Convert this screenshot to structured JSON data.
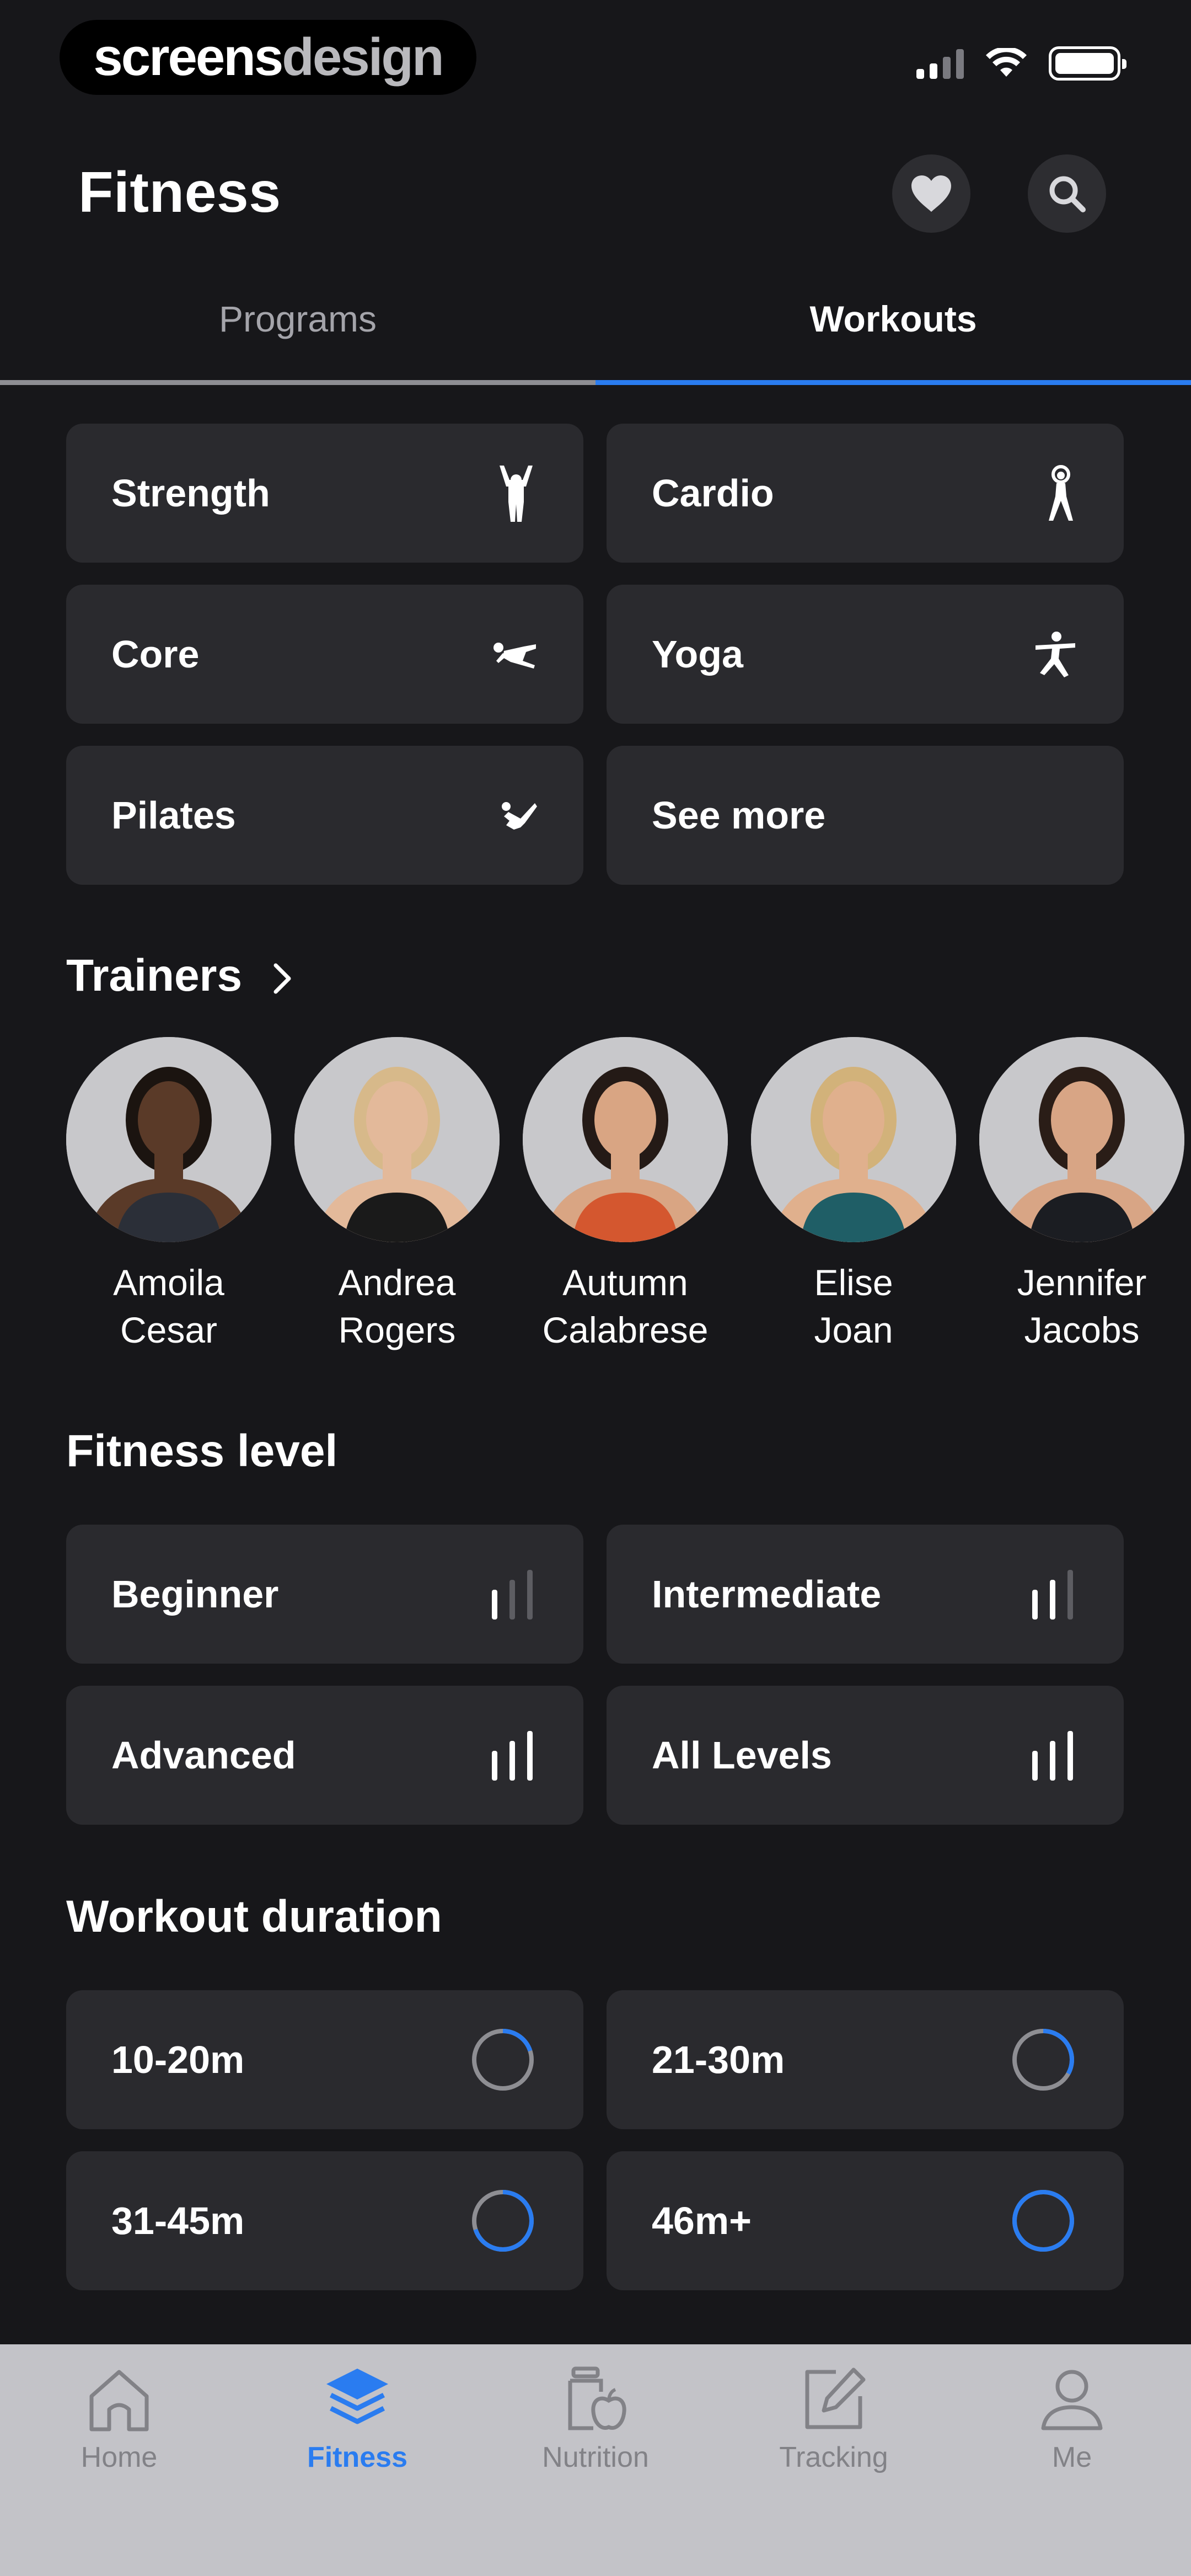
{
  "status_bar": {
    "brand_a": "screens",
    "brand_b": "design"
  },
  "header": {
    "title": "Fitness"
  },
  "tabs": [
    {
      "label": "Programs",
      "active": false
    },
    {
      "label": "Workouts",
      "active": true
    }
  ],
  "categories": [
    {
      "label": "Strength",
      "icon": "strength-figure-icon"
    },
    {
      "label": "Cardio",
      "icon": "cardio-figure-icon"
    },
    {
      "label": "Core",
      "icon": "core-figure-icon"
    },
    {
      "label": "Yoga",
      "icon": "yoga-figure-icon"
    },
    {
      "label": "Pilates",
      "icon": "pilates-figure-icon"
    },
    {
      "label": "See more",
      "icon": ""
    }
  ],
  "trainers_section": {
    "title": "Trainers"
  },
  "trainers": [
    {
      "first": "Amoila",
      "last": "Cesar",
      "skin": "#5a3a28",
      "hair": "#1b1410",
      "top": "#2b2f38"
    },
    {
      "first": "Andrea",
      "last": "Rogers",
      "skin": "#e3b99a",
      "hair": "#d7b98a",
      "top": "#1a1a1a"
    },
    {
      "first": "Autumn",
      "last": "Calabrese",
      "skin": "#d9a583",
      "hair": "#241a16",
      "top": "#d4572f"
    },
    {
      "first": "Elise",
      "last": "Joan",
      "skin": "#e0b08d",
      "hair": "#d2b27a",
      "top": "#1f5e66"
    },
    {
      "first": "Jennifer",
      "last": "Jacobs",
      "skin": "#d8a585",
      "hair": "#2a1d17",
      "top": "#1b1d22"
    }
  ],
  "fitness_level": {
    "title": "Fitness level",
    "items": [
      {
        "label": "Beginner",
        "level": 1
      },
      {
        "label": "Intermediate",
        "level": 2
      },
      {
        "label": "Advanced",
        "level": 3
      },
      {
        "label": "All Levels",
        "level": 3
      }
    ]
  },
  "workout_duration": {
    "title": "Workout duration",
    "items": [
      {
        "label": "10-20m",
        "fraction": 0.2
      },
      {
        "label": "21-30m",
        "fraction": 0.33
      },
      {
        "label": "31-45m",
        "fraction": 0.7
      },
      {
        "label": "46m+",
        "fraction": 1.0
      }
    ]
  },
  "tab_bar": [
    {
      "label": "Home",
      "icon": "home-icon",
      "active": false
    },
    {
      "label": "Fitness",
      "icon": "layers-icon",
      "active": true
    },
    {
      "label": "Nutrition",
      "icon": "nutrition-icon",
      "active": false
    },
    {
      "label": "Tracking",
      "icon": "edit-icon",
      "active": false
    },
    {
      "label": "Me",
      "icon": "person-icon",
      "active": false
    }
  ],
  "colors": {
    "accent": "#2a7cf0",
    "card": "#2a2a2e",
    "background": "#17171a",
    "ring_track": "#8e8e93"
  }
}
